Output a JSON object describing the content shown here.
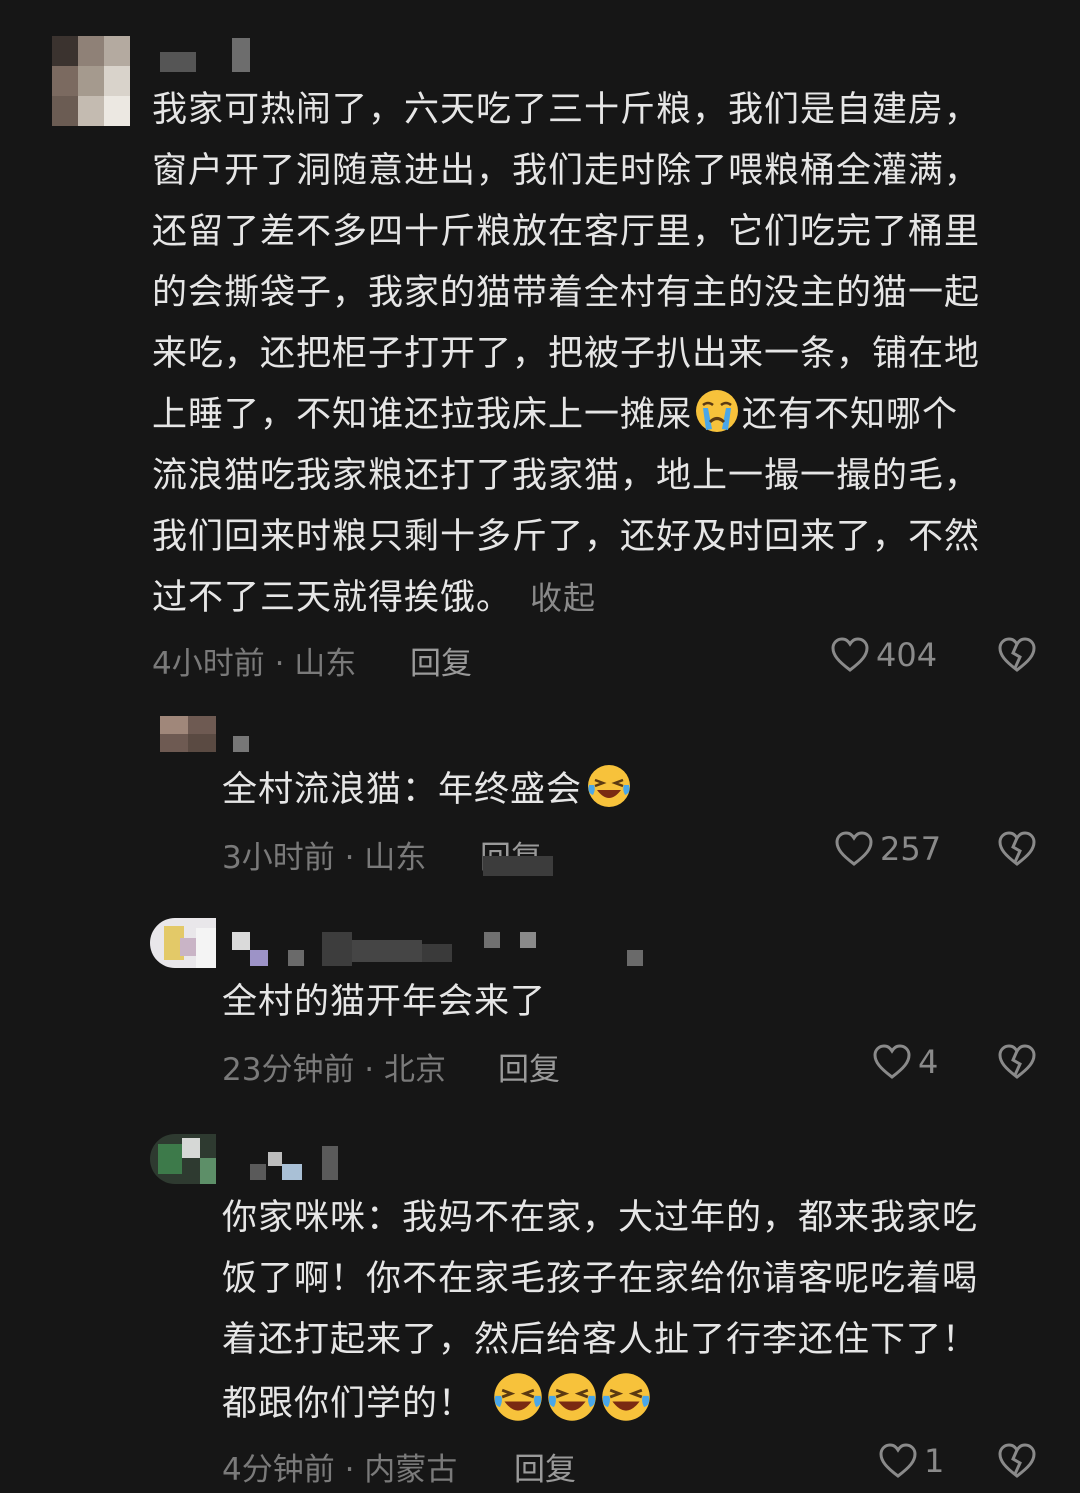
{
  "comments": [
    {
      "text": "我家可热闹了，六天吃了三十斤粮，我们是自建房，\n窗户开了洞随意进出，我们走时除了喂粮桶全灌满，\n还留了差不多四十斤粮放在客厅里，它们吃完了桶里\n的会撕袋子，我家的猫带着全村有主的没主的猫一起\n来吃，还把柜子打开了，把被子扒出来一条，铺在地\n上睡了，不知谁还拉我床上一摊屎",
      "text_after_emoji": "还有不知哪个\n流浪猫吃我家粮还打了我家猫，地上一撮一撮的毛，\n我们回来时粮只剩十多斤了，还好及时回来了，不然\n过不了三天就得挨饿。",
      "collapse_label": "收起",
      "meta": "4小时前 · 山东",
      "reply_label": "回复",
      "likes": "404",
      "emoji": "crying-face-icon"
    },
    {
      "text": "全村流浪猫：年终盛会",
      "meta": "3小时前 · 山东",
      "reply_label": "回复",
      "likes": "257",
      "emoji": "laughing-crying-face-icon"
    },
    {
      "text": "全村的猫开年会来了",
      "meta": "23分钟前 · 北京",
      "reply_label": "回复",
      "likes": "4"
    },
    {
      "text": "你家咪咪：我妈不在家，大过年的，都来我家吃\n饭了啊！你不在家毛孩子在家给你请客呢吃着喝\n着还打起来了，然后给客人扯了行李还住下了！\n都跟你们学的！",
      "meta": "4分钟前 · 内蒙古",
      "reply_label": "回复",
      "likes": "1",
      "emoji": "laughing-crying-face-icon"
    }
  ],
  "colors": {
    "background": "#161616",
    "text": "#e6e6e6",
    "meta": "#7a7a7a",
    "icon": "#8a8a8a"
  }
}
